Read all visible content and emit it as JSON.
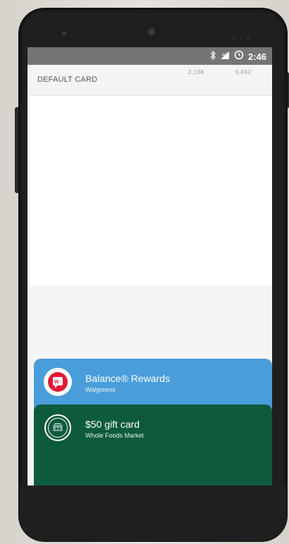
{
  "status_bar": {
    "icons": [
      "bluetooth-icon",
      "signal-icon",
      "alarm-icon"
    ],
    "time": "2:46"
  },
  "header": {
    "label": "DEFAULT CARD",
    "num1": "2,168",
    "num2": "5,842"
  },
  "cards": [
    {
      "title": "Balance® Rewards",
      "subtitle": "Walgreens",
      "color": "#4a9ddb",
      "logo": "walgreens-logo"
    },
    {
      "title": "$50 gift card",
      "subtitle": "Whole Foods Market",
      "color": "#0d5a3d",
      "logo": "whole-foods-logo"
    }
  ],
  "colors": {
    "status_bar": "#757575",
    "device": "#1f1f1f",
    "screen_bg": "#f5f5f5"
  }
}
